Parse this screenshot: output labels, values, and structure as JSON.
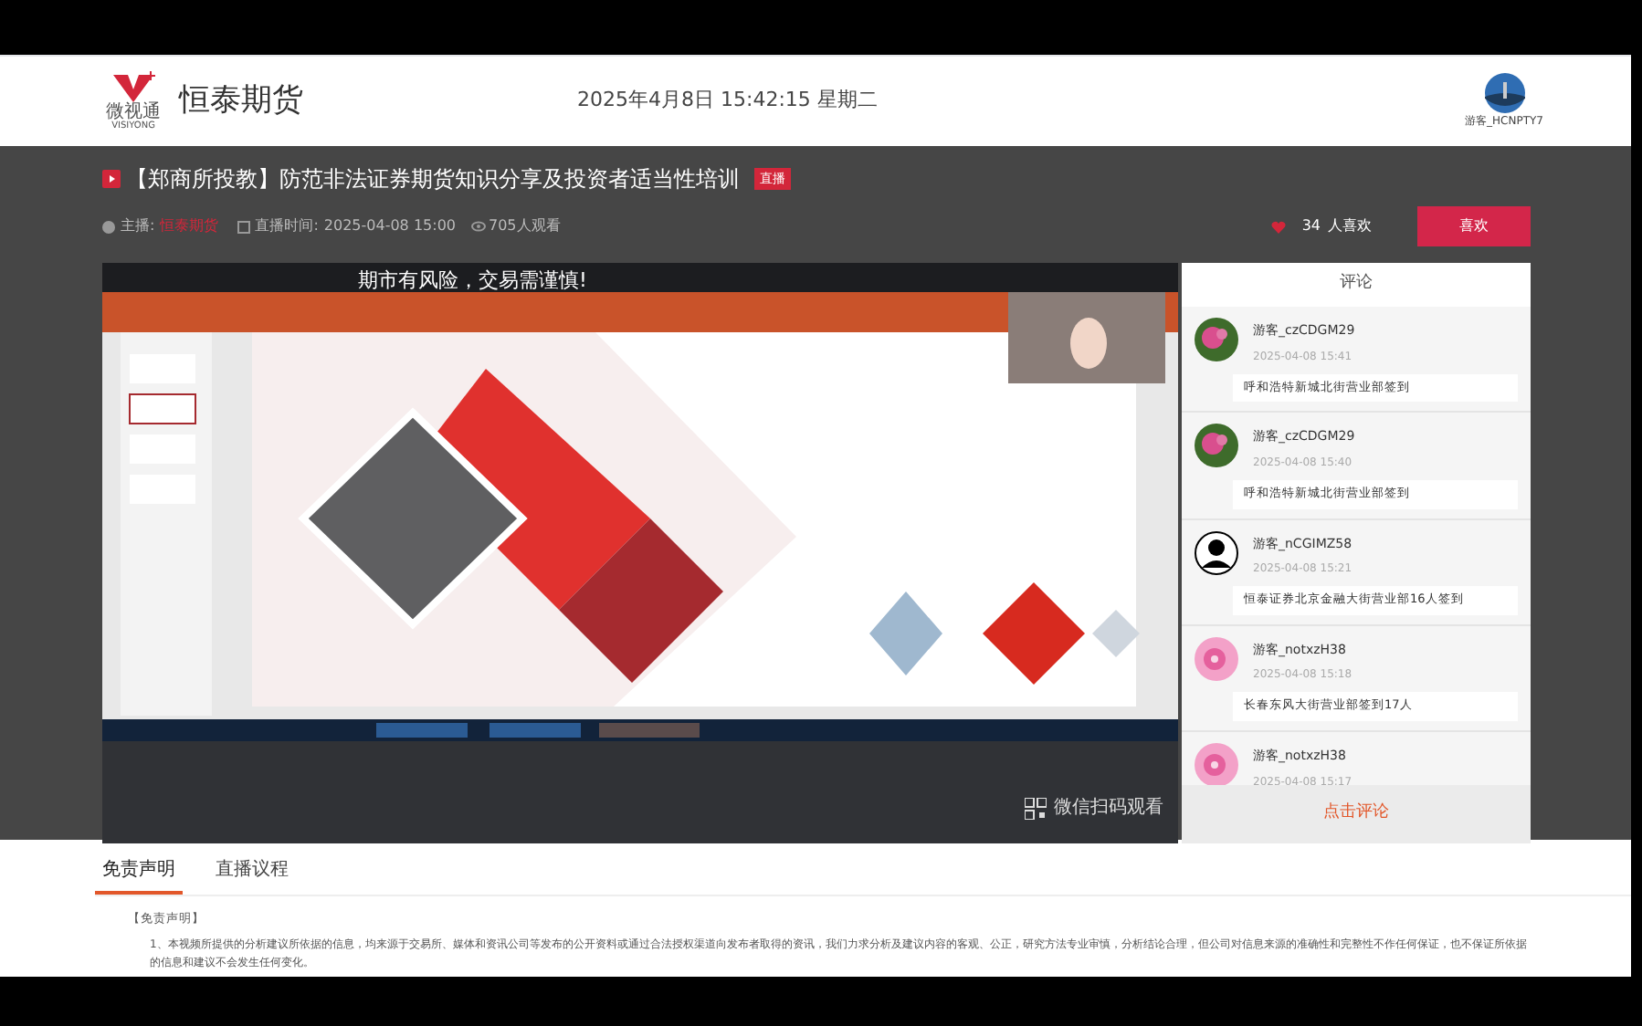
{
  "header": {
    "logo_text": "微视通",
    "logo_subtext": "VISIYONG",
    "brand": "恒泰期货",
    "datetime": "2025年4月8日  15:42:15  星期二",
    "user": "游客_HCNPTY7"
  },
  "live": {
    "badge_text": "直播",
    "title": "【郑商所投教】防范非法证券期货知识分享及投资者适当性培训",
    "host_label": "主播:",
    "host": "恒泰期货",
    "time_label": "直播时间:",
    "time": "2025-04-08 15:00",
    "viewers": "705人观看",
    "likes": "34",
    "likes_label": "人喜欢",
    "like_button": "喜欢"
  },
  "video": {
    "kind": "picture",
    "banner": "期市有风险，交易需谨慎!",
    "qr_label": "微信扫码观看"
  },
  "comments": {
    "title": "评论",
    "items": [
      {
        "name": "游客_czCDGM29",
        "time": "2025-04-08 15:41",
        "text": "呼和浩特新城北街营业部签到",
        "kind": "flower"
      },
      {
        "name": "游客_czCDGM29",
        "time": "2025-04-08 15:40",
        "text": "呼和浩特新城北街营业部签到",
        "kind": "flower"
      },
      {
        "name": "游客_nCGIMZ58",
        "time": "2025-04-08 15:21",
        "text": "恒泰证券北京金融大街营业部16人签到",
        "kind": "person"
      },
      {
        "name": "游客_notxzH38",
        "time": "2025-04-08 15:18",
        "text": "长春东风大街营业部签到17人",
        "kind": "pink"
      },
      {
        "name": "游客_notxzH38",
        "time": "2025-04-08 15:17",
        "kind": "pink"
      }
    ],
    "action": "点击评论"
  },
  "tabs": [
    {
      "label": "免责声明",
      "selected": true
    },
    {
      "label": "直播议程",
      "selected": false
    }
  ],
  "disclaimer": {
    "heading": "【免责声明】",
    "paragraph": "1、本视频所提供的分析建议所依据的信息，均来源于交易所、媒体和资讯公司等发布的公开资料或通过合法授权渠道向发布者取得的资讯，我们力求分析及建议内容的客观、公正，研究方法专业审慎，分析结论合理，但公司对信息来源的准确性和完整性不作任何保证，也不保证所依据的信息和建议不会发生任何变化。"
  }
}
